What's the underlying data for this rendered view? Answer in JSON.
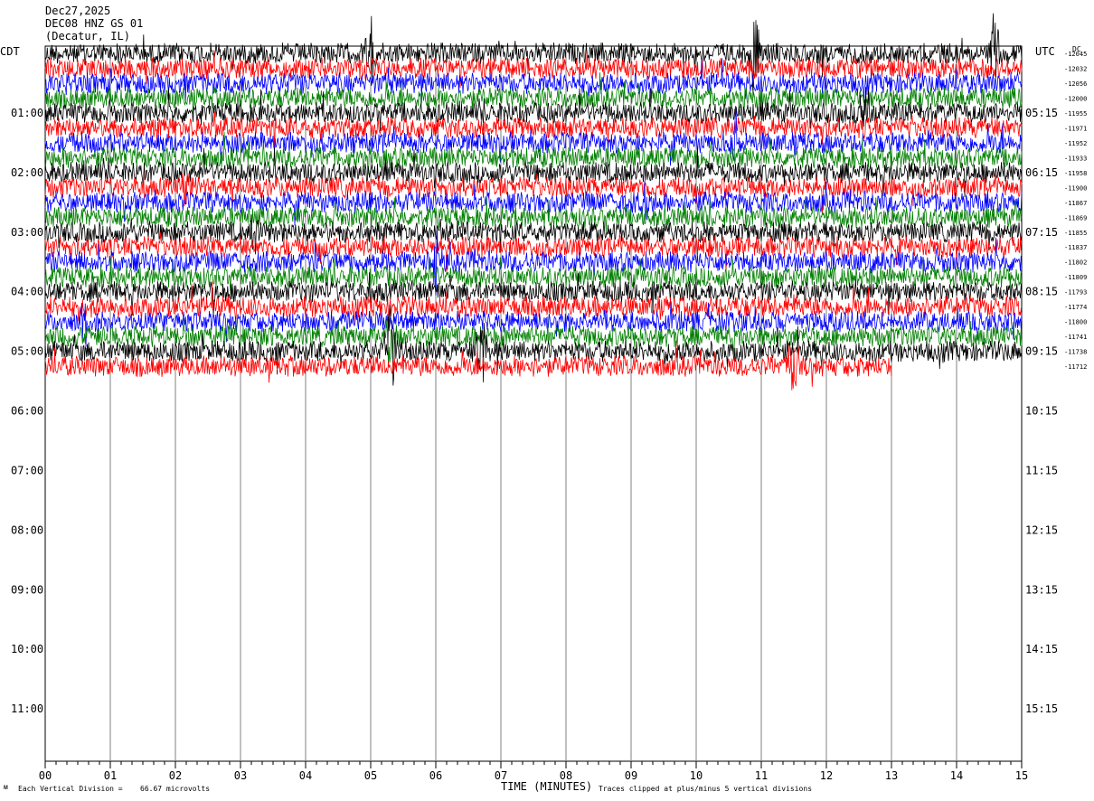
{
  "header": {
    "date": "Dec27,2025",
    "station": "DEC08 HNZ GS 01",
    "location": "(Decatur, IL)"
  },
  "labels": {
    "left_zone": "CDT",
    "right_zone": "UTC",
    "right_offset": "DC"
  },
  "footer": {
    "left_note": "Each Vertical Division =",
    "left_value": "66.67 microvolts",
    "xlabel": "TIME (MINUTES)",
    "right_note": "Traces clipped at plus/minus 5 vertical divisions"
  },
  "colors": {
    "cycle": [
      "#000000",
      "#ff0000",
      "#0000ff",
      "#008000"
    ],
    "grid": "#808080"
  },
  "chart_data": {
    "type": "line",
    "title": "",
    "xlabel": "TIME (MINUTES)",
    "xlim": [
      0,
      15
    ],
    "x_ticks": [
      "00",
      "01",
      "02",
      "03",
      "04",
      "05",
      "06",
      "07",
      "08",
      "09",
      "10",
      "11",
      "12",
      "13",
      "14",
      "15"
    ],
    "rows_total": 48,
    "row_minutes": 15,
    "left_time_labels": [
      "01:00",
      "02:00",
      "03:00",
      "04:00",
      "05:00",
      "06:00",
      "07:00",
      "08:00",
      "09:00",
      "10:00",
      "11:00"
    ],
    "right_time_labels": [
      "05:15",
      "06:15",
      "07:15",
      "08:15",
      "09:15",
      "10:15",
      "11:15",
      "12:15",
      "13:15",
      "14:15",
      "15:15"
    ],
    "trace_rows": [
      {
        "offset": "-12045"
      },
      {
        "offset": "-12032"
      },
      {
        "offset": "-12056"
      },
      {
        "offset": "-12000"
      },
      {
        "offset": "-11955"
      },
      {
        "offset": "-11971"
      },
      {
        "offset": "-11952"
      },
      {
        "offset": "-11933"
      },
      {
        "offset": "-11958"
      },
      {
        "offset": "-11900"
      },
      {
        "offset": "-11867"
      },
      {
        "offset": "-11869"
      },
      {
        "offset": "-11855"
      },
      {
        "offset": "-11837"
      },
      {
        "offset": "-11802"
      },
      {
        "offset": "-11809"
      },
      {
        "offset": "-11793"
      },
      {
        "offset": "-11774"
      },
      {
        "offset": "-11800"
      },
      {
        "offset": "-11741"
      },
      {
        "offset": "-11738"
      },
      {
        "offset": "-11712",
        "end_minute": 13.0
      }
    ],
    "events": [
      {
        "row": 0,
        "minute": 5.0,
        "amp": 3.5
      },
      {
        "row": 0,
        "minute": 10.9,
        "amp": 3.5
      },
      {
        "row": 0,
        "minute": 14.6,
        "amp": 3.0
      },
      {
        "row": 4,
        "minute": 12.6,
        "amp": 2.5
      },
      {
        "row": 6,
        "minute": 10.6,
        "amp": 2.5
      },
      {
        "row": 9,
        "minute": 2.2,
        "amp": 2.0
      },
      {
        "row": 10,
        "minute": 9.2,
        "amp": 2.0
      },
      {
        "row": 12,
        "minute": 3.2,
        "amp": 2.5
      },
      {
        "row": 14,
        "minute": 6.0,
        "amp": 3.0
      },
      {
        "row": 18,
        "minute": 0.6,
        "amp": 2.0
      },
      {
        "row": 19,
        "minute": 5.3,
        "amp": 3.0
      },
      {
        "row": 20,
        "minute": 5.3,
        "amp": 4.5
      },
      {
        "row": 20,
        "minute": 6.7,
        "amp": 4.5
      },
      {
        "row": 21,
        "minute": 11.5,
        "amp": 3.0
      }
    ]
  }
}
